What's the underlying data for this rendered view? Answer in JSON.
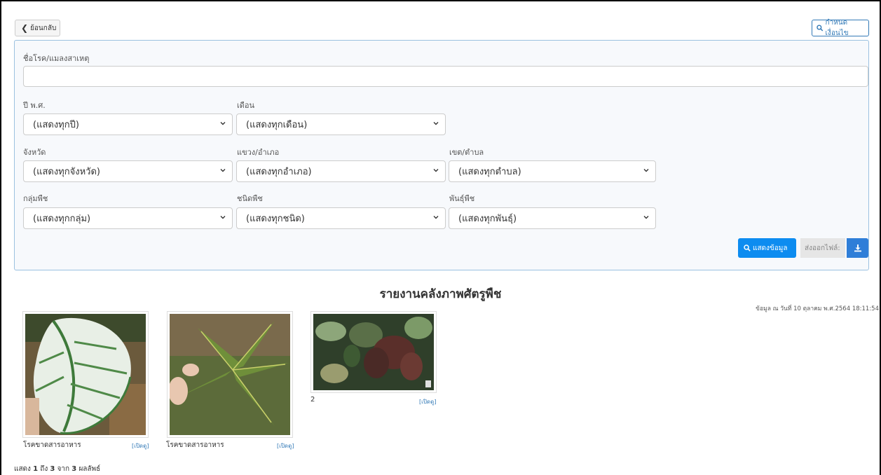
{
  "header": {
    "back_label": "ย้อนกลับ",
    "condition_label": "กำหนดเงื่อนไข"
  },
  "filters": {
    "disease_label": "ชื่อโรค/แมลงสาเหตุ",
    "disease_value": "",
    "year_label": "ปี พ.ศ.",
    "year_value": "(แสดงทุกปี)",
    "month_label": "เดือน",
    "month_value": "(แสดงทุกเดือน)",
    "province_label": "จังหวัด",
    "province_value": "(แสดงทุกจังหวัด)",
    "district_label": "แขวง/อำเภอ",
    "district_value": "(แสดงทุกอำเภอ)",
    "subdistrict_label": "เขต/ตำบล",
    "subdistrict_value": "(แสดงทุกตำบล)",
    "plant_group_label": "กลุ่มพืช",
    "plant_group_value": "(แสดงทุกกลุ่ม)",
    "plant_type_label": "ชนิดพืช",
    "plant_type_value": "(แสดงทุกชนิด)",
    "variety_label": "พันธุ์พืช",
    "variety_value": "(แสดงทุกพันธุ์)"
  },
  "actions": {
    "show_label": "แสดงข้อมูล",
    "export_label": "ส่งออกไฟล์:"
  },
  "report": {
    "title": "รายงานคลังภาพศัตรูพืช",
    "timestamp": "ข้อมูล ณ วันที่ 10 ตุลาคม พ.ศ.2564 18:11:54"
  },
  "cards": [
    {
      "caption": "โรคขาดสารอาหาร",
      "link": "[เปิดดู]"
    },
    {
      "caption": "โรคขาดสารอาหาร",
      "link": "[เปิดดู]"
    },
    {
      "caption": "2",
      "link": "[เปิดดู]"
    }
  ],
  "pagination": {
    "prefix": "แสดง",
    "from": "1",
    "to_word": "ถึง",
    "to": "3",
    "of_word": "จาก",
    "total": "3",
    "suffix": "ผลลัพธ์"
  },
  "colors": {
    "primary": "#0d8cf0",
    "panel_border": "#9bc1e0",
    "link": "#337ab7"
  },
  "icons": {
    "back": "chevron-left-icon",
    "search": "search-icon",
    "download": "download-icon",
    "dropdown": "chevron-down-icon"
  }
}
